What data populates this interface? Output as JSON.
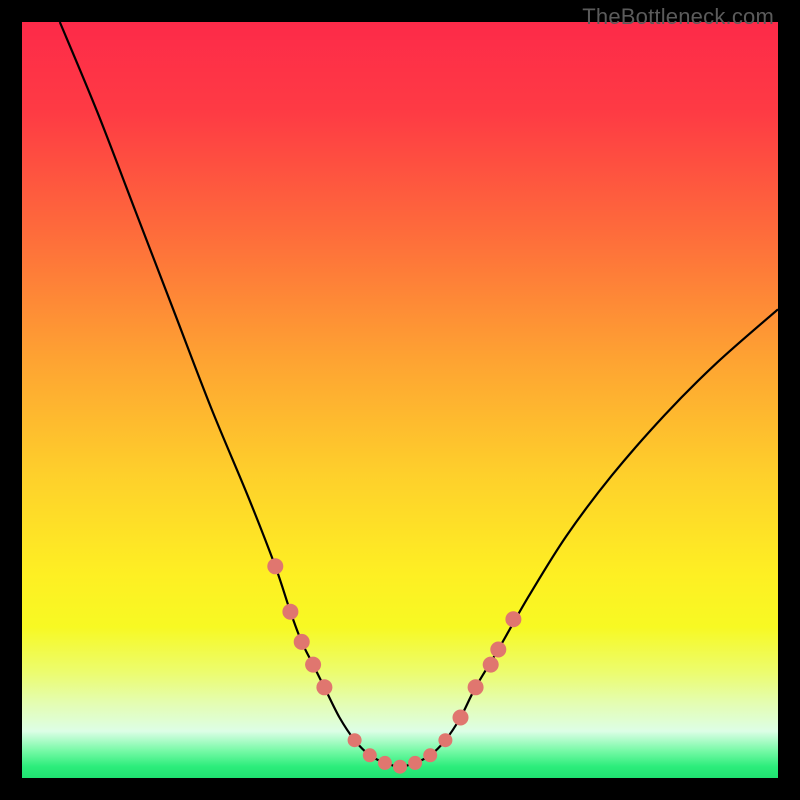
{
  "watermark": "TheBottleneck.com",
  "colors": {
    "black": "#000000",
    "curve": "#000000",
    "dot": "#e0766f",
    "gradient_stops": [
      {
        "offset": 0.0,
        "color": "#fd2a49"
      },
      {
        "offset": 0.12,
        "color": "#fe3b44"
      },
      {
        "offset": 0.28,
        "color": "#fe6c3b"
      },
      {
        "offset": 0.45,
        "color": "#fea432"
      },
      {
        "offset": 0.6,
        "color": "#fed02b"
      },
      {
        "offset": 0.73,
        "color": "#feef23"
      },
      {
        "offset": 0.8,
        "color": "#f7f923"
      },
      {
        "offset": 0.86,
        "color": "#ecfc6e"
      },
      {
        "offset": 0.9,
        "color": "#e4fdb0"
      },
      {
        "offset": 0.938,
        "color": "#ddfee6"
      },
      {
        "offset": 0.965,
        "color": "#73f9a4"
      },
      {
        "offset": 0.985,
        "color": "#2ced7b"
      },
      {
        "offset": 1.0,
        "color": "#1fe271"
      }
    ]
  },
  "chart_data": {
    "type": "line",
    "title": "",
    "xlabel": "",
    "ylabel": "",
    "xlim": [
      0,
      100
    ],
    "ylim": [
      0,
      100
    ],
    "x": [
      5,
      10,
      15,
      20,
      25,
      30,
      33.5,
      35.5,
      37,
      38.5,
      40,
      42,
      44,
      46,
      48,
      50,
      52,
      54,
      56,
      58,
      60,
      63,
      67,
      72,
      78,
      85,
      92,
      100
    ],
    "values": [
      100,
      88,
      75,
      62,
      49,
      37,
      28,
      22,
      18,
      15,
      12,
      8,
      5,
      3,
      2,
      1.5,
      2,
      3,
      5,
      8,
      12,
      17,
      24,
      32,
      40,
      48,
      55,
      62
    ],
    "markers": {
      "left_cluster_x": [
        33.5,
        35.5,
        37.0,
        38.5,
        40.0
      ],
      "left_cluster_y": [
        28,
        22,
        18,
        15,
        12
      ],
      "bottom_cluster_x": [
        44,
        46,
        48,
        50,
        52,
        54,
        56
      ],
      "bottom_cluster_y": [
        5,
        3,
        2,
        1.5,
        2,
        3,
        5
      ],
      "right_cluster_x": [
        58,
        60,
        62,
        63,
        65
      ],
      "right_cluster_y": [
        8,
        12,
        15,
        17,
        21
      ]
    }
  }
}
